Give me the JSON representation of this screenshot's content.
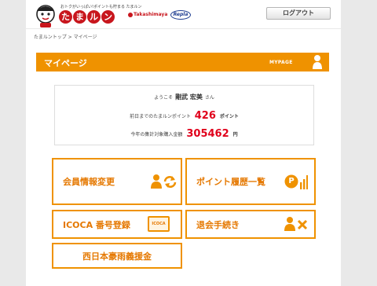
{
  "header": {
    "tagline": "おトクがいっぱい!ポイントも貯まる たまルン",
    "logo_chars": [
      "た",
      "ま",
      "ル",
      "ン"
    ],
    "partner1": "Takashimaya",
    "partner2": "Repla",
    "logout_label": "ログアウト"
  },
  "breadcrumb": {
    "home": "たまルントップ",
    "separator": ">",
    "current": "マイページ"
  },
  "title_bar": {
    "title": "マイページ",
    "subtitle": "MYPAGE"
  },
  "info": {
    "welcome_prefix": "ようこそ",
    "user_name": "剛武 宏美",
    "honorific": "さん",
    "points_label": "前日までのたまルンポイント",
    "points_value": "426",
    "points_unit": "ポイント",
    "purchase_label": "今年の集計対象購入金額",
    "purchase_value": "305462",
    "purchase_unit": "円"
  },
  "menu": {
    "member_info": "会員情報変更",
    "point_history": "ポイント履歴一覧",
    "icoca": "ICOCA 番号登録",
    "icoca_card_text": "ICOCA",
    "withdraw": "退会手続き",
    "donation": "西日本豪雨義援金",
    "point_icon_letter": "P"
  },
  "colors": {
    "accent": "#ef9200",
    "accent_text": "#e57800",
    "value_red": "#e0001b",
    "logo_red": "#c8161d"
  },
  "icons": [
    "mascot-icon",
    "person-icon",
    "person-refresh-icon",
    "point-chart-icon",
    "icoca-card-icon",
    "person-close-icon"
  ]
}
